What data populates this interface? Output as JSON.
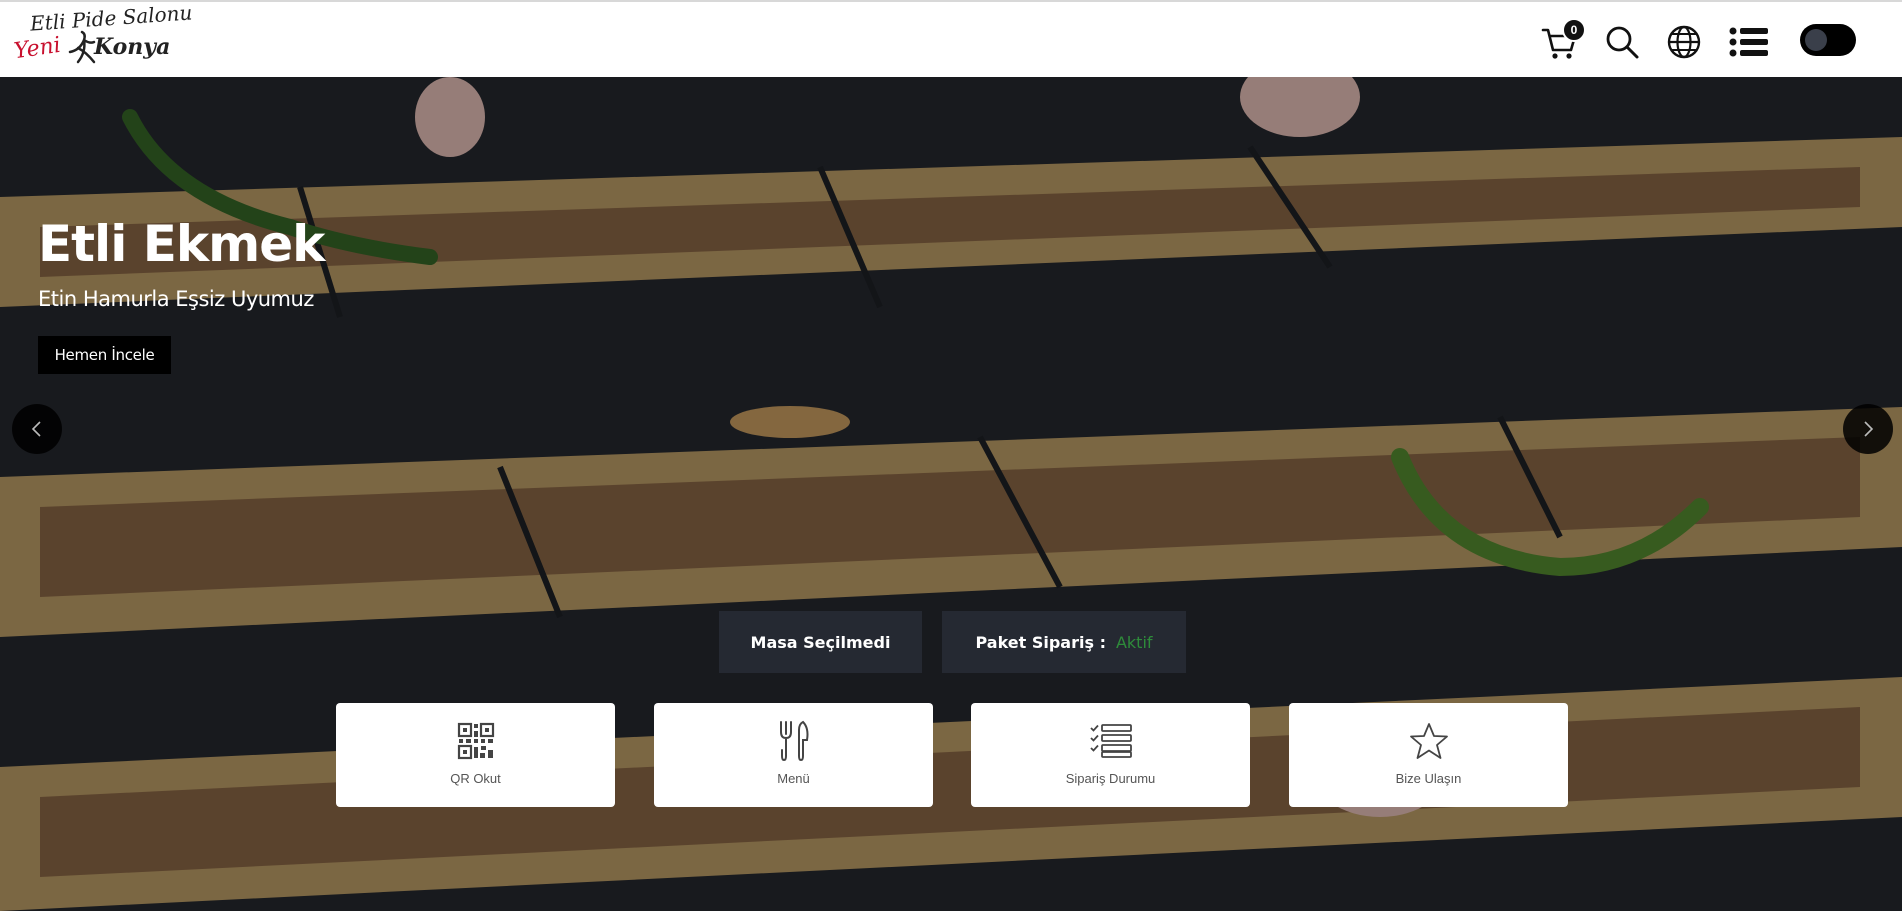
{
  "header": {
    "logo": {
      "top_text": "Etli Pide Salonu",
      "script_text": "Yeni",
      "brand_text": "Konya"
    },
    "cart": {
      "count": "0"
    }
  },
  "hero": {
    "title": "Etli Ekmek",
    "subtitle": "Etin Hamurla Eşsiz Uyumuz",
    "button_label": "Hemen İncele"
  },
  "status": {
    "masa_label": "Masa Seçilmedi",
    "paket_label": "Paket Sipariş :",
    "paket_value": "Aktif"
  },
  "cards": [
    {
      "label": "QR Okut",
      "icon": "qr-code-icon"
    },
    {
      "label": "Menü",
      "icon": "fork-knife-icon"
    },
    {
      "label": "Sipariş Durumu",
      "icon": "checklist-icon"
    },
    {
      "label": "Bize Ulaşın",
      "icon": "star-icon"
    }
  ],
  "colors": {
    "status_bg": "#252932",
    "active_green": "#2e8b3a",
    "toggle_bg": "#000000"
  }
}
